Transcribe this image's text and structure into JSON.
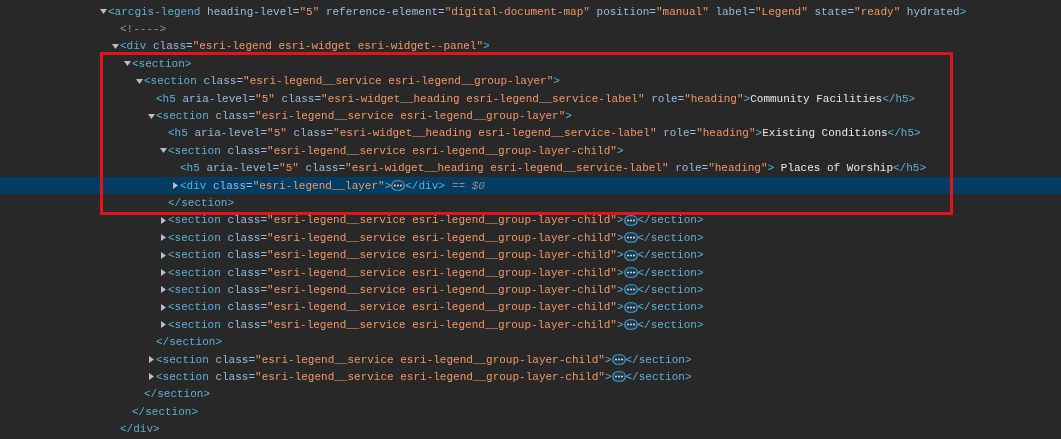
{
  "tree": {
    "kind": "element",
    "expanded": true,
    "selected": false,
    "open": "<arcgis-legend",
    "end": ">",
    "attrs": [
      {
        "name": "heading-level=",
        "value": "\"5\""
      },
      {
        "name": "reference-element=",
        "value": "\"digital-document-map\""
      },
      {
        "name": "position=",
        "value": "\"manual\""
      },
      {
        "name": "label=",
        "value": "\"Legend\""
      },
      {
        "name": "state=",
        "value": "\"ready\""
      },
      {
        "name": "hydrated"
      }
    ],
    "children": [
      {
        "kind": "comment",
        "text": "<!---->"
      },
      {
        "kind": "element",
        "expanded": true,
        "selected": false,
        "open": "<div",
        "end": ">",
        "attrs": [
          {
            "name": "class=",
            "value": "\"esri-legend esri-widget esri-widget--panel\""
          }
        ],
        "close": "</div>",
        "children": [
          {
            "kind": "element",
            "expanded": true,
            "selected": false,
            "boxed": true,
            "open": "<section",
            "end": ">",
            "close": "</section>",
            "children": [
              {
                "kind": "element",
                "expanded": true,
                "selected": false,
                "boxed": true,
                "open": "<section",
                "end": ">",
                "attrs": [
                  {
                    "name": "class=",
                    "value": "\"esri-legend__service esri-legend__group-layer\""
                  }
                ],
                "close": "</section>",
                "children": [
                  {
                    "kind": "inline",
                    "selected": false,
                    "boxed": true,
                    "open": "<h5",
                    "end": ">",
                    "attrs": [
                      {
                        "name": "aria-level=",
                        "value": "\"5\""
                      },
                      {
                        "name": "class=",
                        "value": "\"esri-widget__heading esri-legend__service-label\""
                      },
                      {
                        "name": "role=",
                        "value": "\"heading\""
                      }
                    ],
                    "text": "Community Facilities",
                    "close": "</h5>"
                  },
                  {
                    "kind": "element",
                    "expanded": true,
                    "selected": false,
                    "boxed": true,
                    "open": "<section",
                    "end": ">",
                    "attrs": [
                      {
                        "name": "class=",
                        "value": "\"esri-legend__service esri-legend__group-layer\""
                      }
                    ],
                    "close": "</section>",
                    "children": [
                      {
                        "kind": "inline",
                        "selected": false,
                        "boxed": true,
                        "open": "<h5",
                        "end": ">",
                        "attrs": [
                          {
                            "name": "aria-level=",
                            "value": "\"5\""
                          },
                          {
                            "name": "class=",
                            "value": "\"esri-widget__heading esri-legend__service-label\""
                          },
                          {
                            "name": "role=",
                            "value": "\"heading\""
                          }
                        ],
                        "text": "Existing Conditions",
                        "close": "</h5>"
                      },
                      {
                        "kind": "element",
                        "expanded": true,
                        "selected": false,
                        "boxed": true,
                        "close_boxed": true,
                        "open": "<section",
                        "end": ">",
                        "attrs": [
                          {
                            "name": "class=",
                            "value": "\"esri-legend__service esri-legend__group-layer-child\""
                          }
                        ],
                        "close": "</section>",
                        "children": [
                          {
                            "kind": "inline",
                            "selected": false,
                            "boxed": true,
                            "open": "<h5",
                            "end": ">",
                            "attrs": [
                              {
                                "name": "aria-level=",
                                "value": "\"5\""
                              },
                              {
                                "name": "class=",
                                "value": "\"esri-widget__heading esri-legend__service-label\""
                              },
                              {
                                "name": "role=",
                                "value": "\"heading\""
                              }
                            ],
                            "text": " Places of Worship",
                            "close": "</h5>"
                          },
                          {
                            "kind": "element",
                            "expanded": false,
                            "selected": true,
                            "boxed": true,
                            "open": "<div",
                            "end": ">",
                            "attrs": [
                              {
                                "name": "class=",
                                "value": "\"esri-legend__layer\""
                              }
                            ],
                            "close": "</div>",
                            "suffix": "== $0"
                          }
                        ]
                      },
                      {
                        "kind": "element",
                        "expanded": false,
                        "selected": false,
                        "open": "<section",
                        "end": ">",
                        "attrs": [
                          {
                            "name": "class=",
                            "value": "\"esri-legend__service esri-legend__group-layer-child\""
                          }
                        ],
                        "close": "</section>"
                      },
                      {
                        "kind": "element",
                        "expanded": false,
                        "selected": false,
                        "open": "<section",
                        "end": ">",
                        "attrs": [
                          {
                            "name": "class=",
                            "value": "\"esri-legend__service esri-legend__group-layer-child\""
                          }
                        ],
                        "close": "</section>"
                      },
                      {
                        "kind": "element",
                        "expanded": false,
                        "selected": false,
                        "open": "<section",
                        "end": ">",
                        "attrs": [
                          {
                            "name": "class=",
                            "value": "\"esri-legend__service esri-legend__group-layer-child\""
                          }
                        ],
                        "close": "</section>"
                      },
                      {
                        "kind": "element",
                        "expanded": false,
                        "selected": false,
                        "open": "<section",
                        "end": ">",
                        "attrs": [
                          {
                            "name": "class=",
                            "value": "\"esri-legend__service esri-legend__group-layer-child\""
                          }
                        ],
                        "close": "</section>"
                      },
                      {
                        "kind": "element",
                        "expanded": false,
                        "selected": false,
                        "open": "<section",
                        "end": ">",
                        "attrs": [
                          {
                            "name": "class=",
                            "value": "\"esri-legend__service esri-legend__group-layer-child\""
                          }
                        ],
                        "close": "</section>"
                      },
                      {
                        "kind": "element",
                        "expanded": false,
                        "selected": false,
                        "open": "<section",
                        "end": ">",
                        "attrs": [
                          {
                            "name": "class=",
                            "value": "\"esri-legend__service esri-legend__group-layer-child\""
                          }
                        ],
                        "close": "</section>"
                      },
                      {
                        "kind": "element",
                        "expanded": false,
                        "selected": false,
                        "open": "<section",
                        "end": ">",
                        "attrs": [
                          {
                            "name": "class=",
                            "value": "\"esri-legend__service esri-legend__group-layer-child\""
                          }
                        ],
                        "close": "</section>"
                      }
                    ]
                  },
                  {
                    "kind": "element",
                    "expanded": false,
                    "selected": false,
                    "open": "<section",
                    "end": ">",
                    "attrs": [
                      {
                        "name": "class=",
                        "value": "\"esri-legend__service esri-legend__group-layer-child\""
                      }
                    ],
                    "close": "</section>"
                  },
                  {
                    "kind": "element",
                    "expanded": false,
                    "selected": false,
                    "open": "<section",
                    "end": ">",
                    "attrs": [
                      {
                        "name": "class=",
                        "value": "\"esri-legend__service esri-legend__group-layer-child\""
                      }
                    ],
                    "close": "</section>"
                  }
                ]
              }
            ]
          }
        ]
      }
    ]
  }
}
